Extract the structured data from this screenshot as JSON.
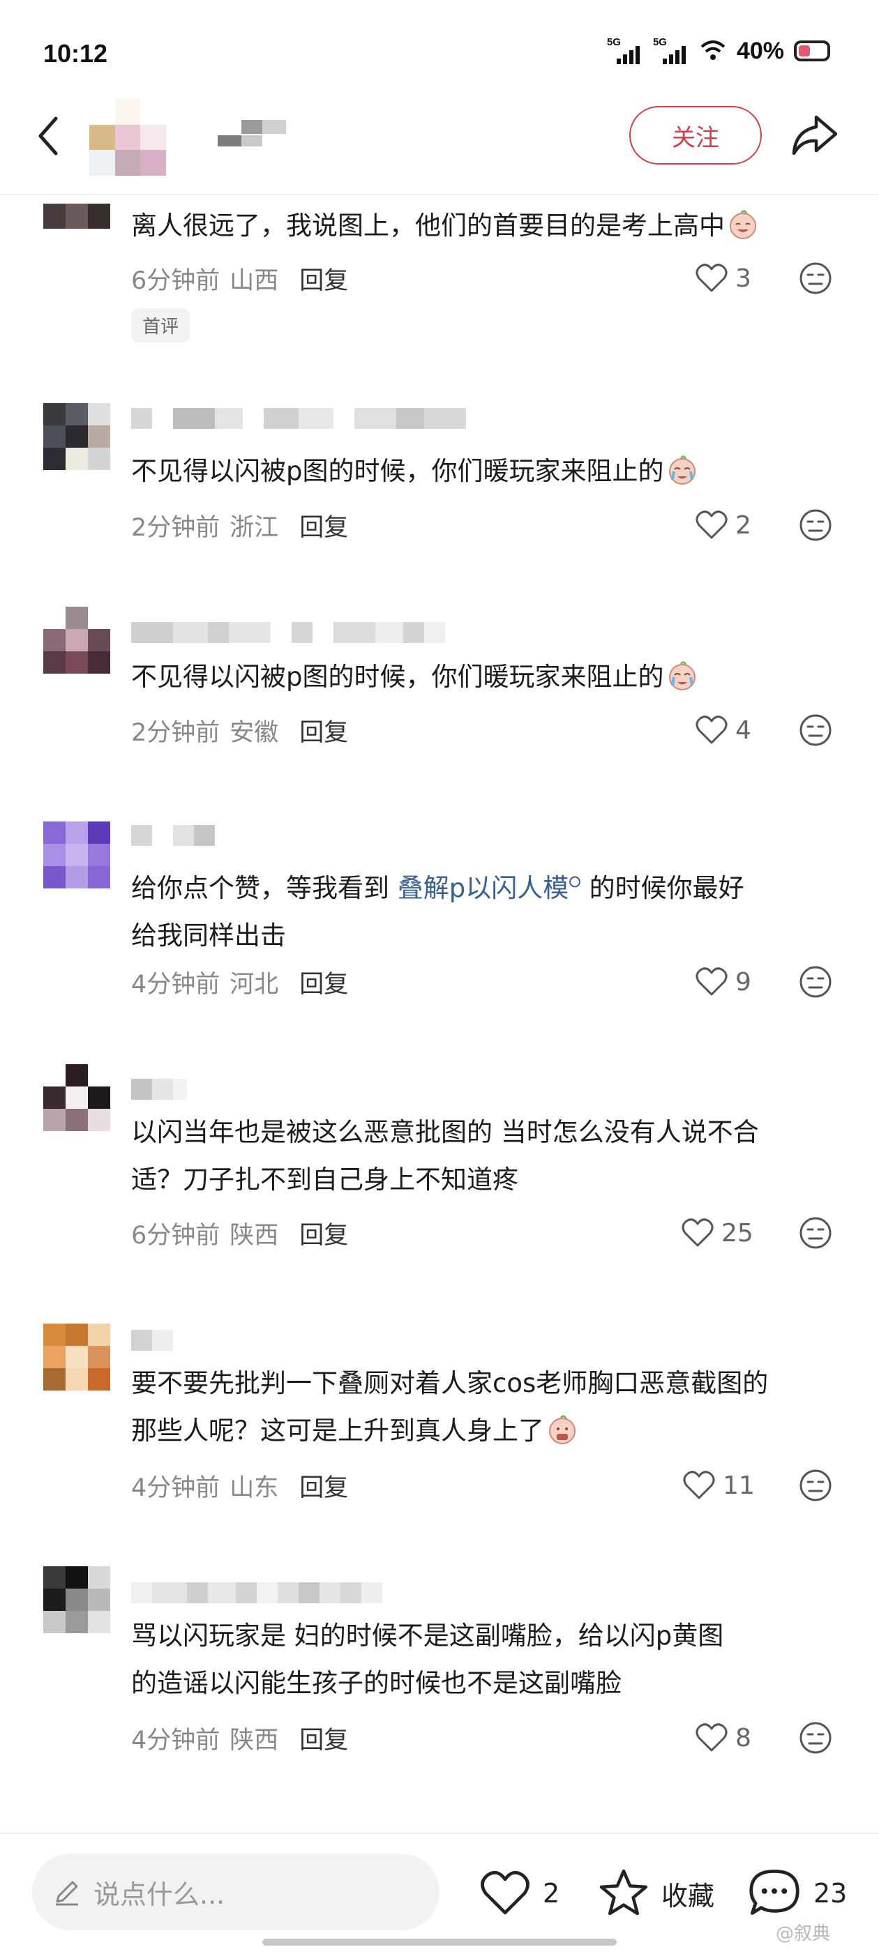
{
  "status_bar": {
    "time": "10:12",
    "signal1": "5G",
    "signal2": "5G",
    "battery_percent": "40%"
  },
  "header": {
    "follow_label": "关注"
  },
  "comments": [
    {
      "text": "离人很远了，我说图上，他们的首要目的是考上高中",
      "time": "6分钟前",
      "region": "山西",
      "reply": "回复",
      "likes": "3",
      "badge": "首评",
      "emoji": "laugh-cry-emoji"
    },
    {
      "text": "不见得以闪被p图的时候，你们暖玩家来阻止的",
      "time": "2分钟前",
      "region": "浙江",
      "reply": "回复",
      "likes": "2",
      "emoji": "cry-emoji"
    },
    {
      "text": "不见得以闪被p图的时候，你们暖玩家来阻止的",
      "time": "2分钟前",
      "region": "安徽",
      "reply": "回复",
      "likes": "4",
      "emoji": "cry-emoji"
    },
    {
      "text_line1_a": "给你点个赞，等我看到 ",
      "link": "叠解p以闪人模",
      "text_line1_b": " 的时候你最好",
      "text_line2": "给我同样出击",
      "time": "4分钟前",
      "region": "河北",
      "reply": "回复",
      "likes": "9"
    },
    {
      "text_line1": "以闪当年也是被这么恶意批图的 当时怎么没有人说不合",
      "text_line2": "适？刀子扎不到自己身上不知道疼",
      "time": "6分钟前",
      "region": "陕西",
      "reply": "回复",
      "likes": "25"
    },
    {
      "text_line1": "要不要先批判一下叠厕对着人家cos老师胸口恶意截图的",
      "text_line2": "那些人呢？这可是上升到真人身上了",
      "time": "4分钟前",
      "region": "山东",
      "reply": "回复",
      "likes": "11",
      "emoji": "shocked-emoji"
    },
    {
      "text_line1": "骂以闪玩家是  妇的时候不是这副嘴脸，给以闪p黄图",
      "text_line2": "的造谣以闪能生孩子的时候也不是这副嘴脸",
      "time": "4分钟前",
      "region": "陕西",
      "reply": "回复",
      "likes": "8"
    }
  ],
  "bottom_bar": {
    "input_placeholder": "说点什么...",
    "likes": "2",
    "collect_label": "收藏",
    "comments_count": "23"
  },
  "watermark": "@叙典"
}
